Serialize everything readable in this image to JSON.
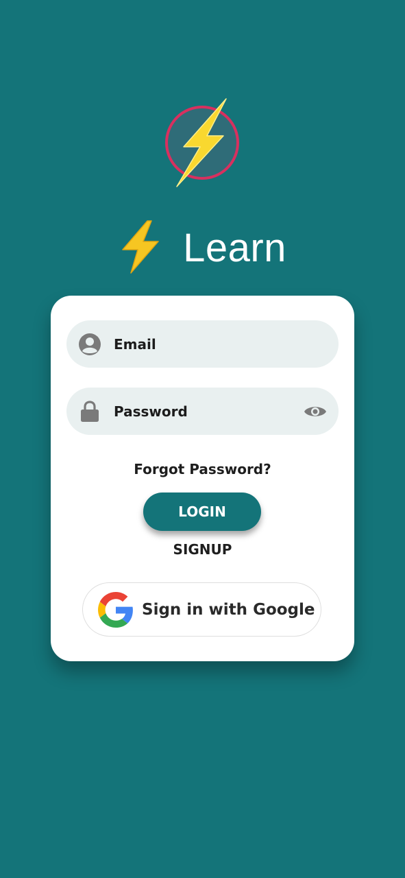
{
  "app": {
    "title": "Learn",
    "logo_icon": "lightning-bolt-icon",
    "brand_icon": "lightning-emoji-icon"
  },
  "form": {
    "email": {
      "placeholder": "Email",
      "value": "",
      "icon": "user-circle-icon"
    },
    "password": {
      "placeholder": "Password",
      "value": "",
      "icon": "lock-icon",
      "toggle_icon": "eye-icon"
    },
    "forgot_password_label": "Forgot Password?",
    "login_label": "LOGIN",
    "signup_label": "SIGNUP",
    "google_label": "Sign in with Google",
    "google_icon": "google-g-icon"
  },
  "colors": {
    "background": "#147479",
    "card": "#ffffff",
    "field_bg": "#e9f0f0",
    "button": "#147479",
    "logo_ring": "#d8305f",
    "bolt": "#f9d82f"
  }
}
